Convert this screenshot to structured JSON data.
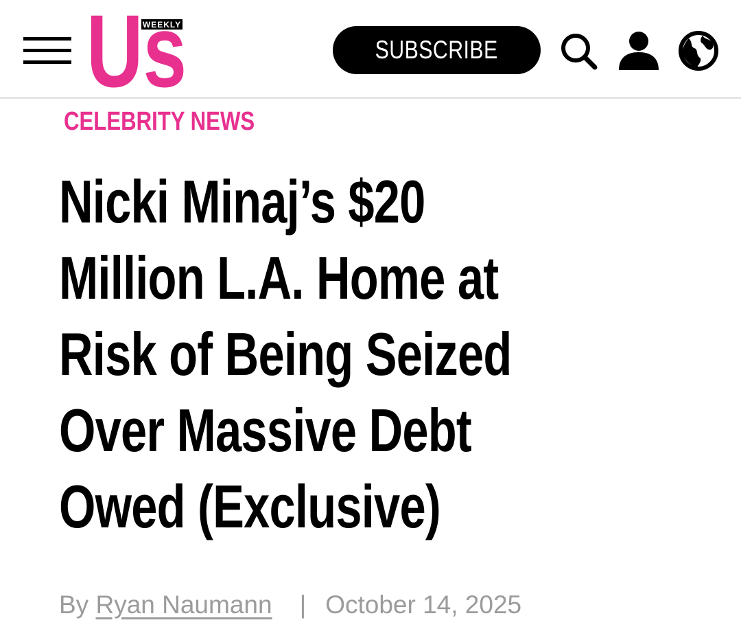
{
  "header": {
    "logo": {
      "text": "Us",
      "badge": "WEEKLY",
      "color": "#e8308f"
    },
    "subscribe_label": "SUBSCRIBE",
    "icons": [
      "menu-icon",
      "search-icon",
      "user-icon",
      "globe-icon"
    ]
  },
  "article": {
    "category": "CELEBRITY NEWS",
    "headline_lines": [
      "Nicki Minaj’s $20",
      "Million L.A. Home at",
      "Risk of Being Seized",
      "Over Massive Debt",
      "Owed (Exclusive)"
    ],
    "byline_prefix": "By",
    "author": "Ryan Naumann",
    "separator": "|",
    "date": "October 14, 2025"
  },
  "colors": {
    "accent": "#e8308f",
    "text": "#000000",
    "muted": "#9b9b9b"
  }
}
